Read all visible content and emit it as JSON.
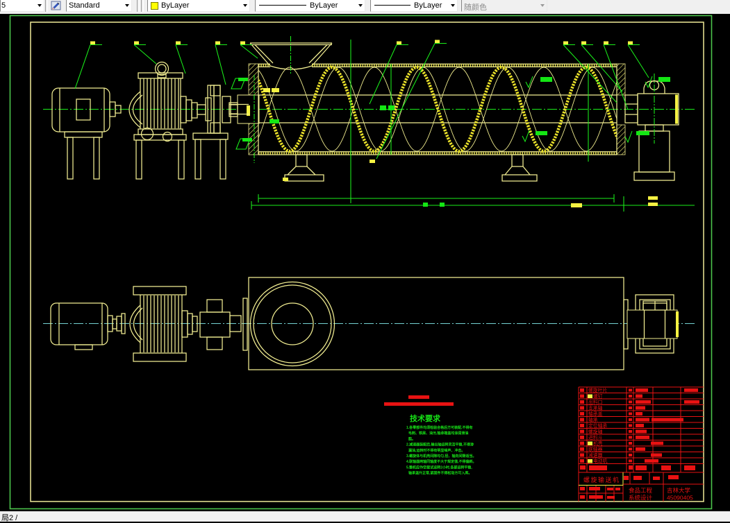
{
  "toolbar": {
    "dim_style_value": "5",
    "text_style_value": "Standard",
    "color_value": "ByLayer",
    "linetype_value": "ByLayer",
    "lineweight_value": "ByLayer",
    "plot_style_value": "随颜色"
  },
  "statusbar": {
    "layout_tab": "局2 /"
  },
  "colors": {
    "background": "#000000",
    "frame_green": "#38b438",
    "frame_yellow": "#f0eb98",
    "geometry_yellow": "#f0ec8e",
    "dimension_green": "#14e614",
    "centerline_cyan": "#74d2d2",
    "annotation_red": "#e81212"
  },
  "tech": {
    "title": "技术要求",
    "lines": [
      "1.各零部件均须检验合格后方可装配,不得有",
      "毛刺、铁屑、油污,轴承端盖均涂润滑油",
      "脂。",
      "2.减速器装配后,输出轴运转灵活平稳,不得渗",
      "漏油,运转时不得有明显噪声、冲击。",
      "3.螺旋体与机壳间隙均匀,径、轴向间隙适当。",
      "4.联轴器两轴同轴度不大于规定值,不得偏斜。",
      "5.整机应作空载试运转2小时,各部运转平稳,",
      "轴承温升正常,紧固件不得松动方可入库。"
    ]
  },
  "titleblock": {
    "parts": [
      "螺旋叶片",
      "螺钉",
      "出料口",
      "支承轴",
      "轴承盖",
      "轴承",
      "定位轴承",
      "螺旋轴",
      "进料斗",
      "机壳",
      "联轴器",
      "减速器",
      "电动机"
    ],
    "title": "螺旋输送机",
    "dept_line1": "食品工程",
    "dept_line2": "系统设计",
    "school": "吉林大学",
    "number": "45090405"
  }
}
